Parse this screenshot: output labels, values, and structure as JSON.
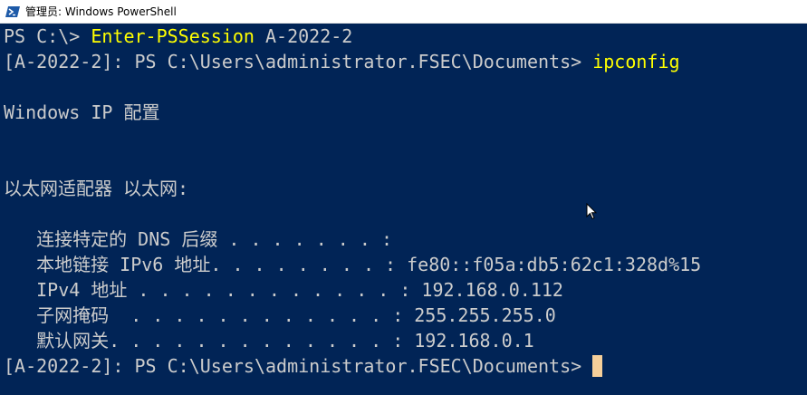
{
  "window": {
    "title": "管理员: Windows PowerShell"
  },
  "colors": {
    "background": "#012456",
    "text": "#cccccc",
    "command": "#ffff00",
    "cursor": "#f5cf9a"
  },
  "terminal": {
    "line1_prompt": "PS C:\\> ",
    "line1_cmd": "Enter-PSSession",
    "line1_arg": " A-2022-2",
    "line2_prompt": "[A-2022-2]: PS C:\\Users\\administrator.FSEC\\Documents> ",
    "line2_cmd": "ipconfig",
    "line4": "Windows IP 配置",
    "line7": "以太网适配器 以太网:",
    "line9": "   连接特定的 DNS 后缀 . . . . . . . :",
    "line10": "   本地链接 IPv6 地址. . . . . . . . : fe80::f05a:db5:62c1:328d%15",
    "line11": "   IPv4 地址 . . . . . . . . . . . . : 192.168.0.112",
    "line12": "   子网掩码  . . . . . . . . . . . . : 255.255.255.0",
    "line13": "   默认网关. . . . . . . . . . . . . : 192.168.0.1",
    "line14_prompt": "[A-2022-2]: PS C:\\Users\\administrator.FSEC\\Documents>"
  },
  "icons": {
    "app": "powershell-icon",
    "pointer": "mouse-pointer-icon"
  }
}
